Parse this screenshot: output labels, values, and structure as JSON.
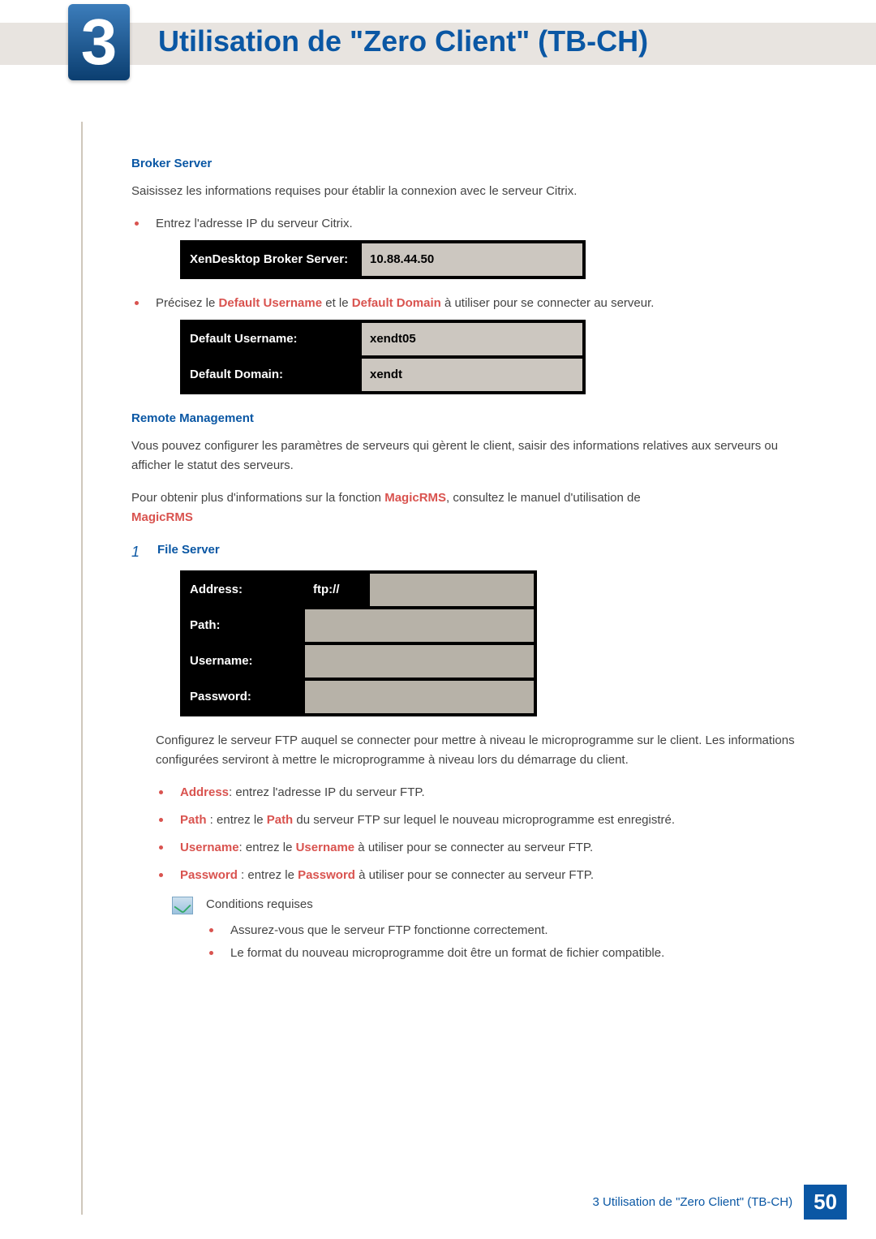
{
  "chapter": {
    "num": "3",
    "title": "Utilisation de \"Zero Client\" (TB-CH)"
  },
  "broker": {
    "heading": "Broker Server",
    "intro": "Saisissez les informations requises pour établir la connexion avec le serveur Citrix.",
    "li1": "Entrez l'adresse IP du serveur Citrix.",
    "row1": {
      "label": "XenDesktop Broker Server:",
      "value": "10.88.44.50"
    },
    "li2_pre": "Précisez le ",
    "li2_b1": "Default Username",
    "li2_mid": " et le ",
    "li2_b2": "Default Domain",
    "li2_post": " à utiliser pour se connecter au serveur.",
    "row2": {
      "label": "Default Username:",
      "value": "xendt05"
    },
    "row3": {
      "label": "Default Domain:",
      "value": "xendt"
    }
  },
  "remote": {
    "heading": "Remote Management",
    "p1": "Vous pouvez configurer les paramètres de serveurs qui gèrent le client, saisir des informations relatives aux serveurs ou afficher le statut des serveurs.",
    "p2_pre": "Pour obtenir plus d'informations sur la fonction ",
    "p2_link1": "MagicRMS",
    "p2_mid": ", consultez le manuel d'utilisation de ",
    "p2_link2": "MagicRMS"
  },
  "file": {
    "step_num": "1",
    "step_label": "File Server",
    "rows": {
      "addr_label": "Address:",
      "addr_proto": "ftp://",
      "path_label": "Path:",
      "user_label": "Username:",
      "pass_label": "Password:"
    },
    "desc": "Configurez le serveur FTP auquel se connecter pour mettre à niveau le microprogramme sur le client. Les informations configurées serviront à mettre le microprogramme à niveau lors du démarrage du client.",
    "d1_b": "Address",
    "d1_t": ": entrez l'adresse IP du serveur FTP.",
    "d2_b": "Path",
    "d2_m": " : entrez le ",
    "d2_b2": "Path",
    "d2_t": " du serveur FTP sur lequel le nouveau microprogramme est enregistré.",
    "d3_b": "Username",
    "d3_m": ": entrez le ",
    "d3_b2": "Username",
    "d3_t": " à utiliser pour se connecter au serveur FTP.",
    "d4_b": "Password",
    "d4_m": " : entrez le ",
    "d4_b2": "Password",
    "d4_t": " à utiliser pour se connecter au serveur FTP."
  },
  "note": {
    "title": "Conditions requises",
    "n1": "Assurez-vous que le serveur FTP fonctionne correctement.",
    "n2": "Le format du nouveau microprogramme doit être un format de fichier compatible."
  },
  "footer": {
    "text": "3 Utilisation de \"Zero Client\" (TB-CH)",
    "page": "50"
  }
}
